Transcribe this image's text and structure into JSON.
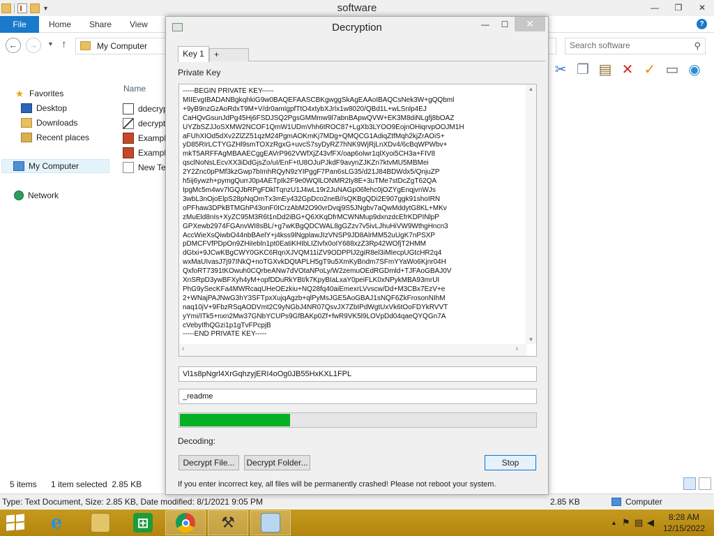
{
  "explorer": {
    "title": "software",
    "ribbon_tabs": [
      "File",
      "Home",
      "Share",
      "View"
    ],
    "address": "My Computer",
    "search_placeholder": "Search software",
    "column_name": "Name",
    "nav": {
      "favorites": "Favorites",
      "desktop": "Desktop",
      "downloads": "Downloads",
      "recent": "Recent places",
      "computer": "My Computer",
      "network": "Network"
    },
    "files": [
      "ddecryp",
      "decrypt",
      "Exampl",
      "Exampl",
      "New Te"
    ],
    "status_items": "5 items",
    "status_selected": "1 item selected  2.85 KB",
    "details_left": "Type: Text Document, Size: 2.85 KB, Date modified: 8/1/2021 9:05 PM",
    "details_size": "2.85 KB",
    "details_computer": "Computer"
  },
  "dialog": {
    "title": "Decryption",
    "tabs": [
      "Key 1",
      "+"
    ],
    "private_key_label": "Private Key",
    "private_key_text": "-----BEGIN PRIVATE KEY-----\nMIIEvgIBADANBgkqhkiG9w0BAQEFAASCBKgwggSkAgEAAoIBAQCsNek3W+gQQbml\n+9yB9nzGzAoRdxT9M+V/dr0amIgpfTtO4xtybXJrlx1w8020/QBd1L+wLSnlp4EJ\nCaHQvGsunJdPg45Hj6FSDJSQ2PgsGMMmw9l7abnBApwQVW+EK3M8diNLgfj8bOAZ\nUYZbSZJJoSXMW2NCOF1QmW1UDmVhh6tROC87+LgXb3LYOO9EojnOHiqrvpOOJM1H\naFUhXIOd5dXv2ZlZZ51qzM24PgmAOKmKj7MDg+QMQCG1AdiqZtfMqh2kjZrAOiS+\nyD85RIrLCTYGZHl9smTOXzRgxG+uvcS7syDyRZ7hNK9WjRjLnXDv4/6cBqWPWbv+\nmkT5ARFFAgMBAAECggEAVrP962VWfXjZ43vfFX/oap6oIwr1qlXyoi5CH3a+FIV8\nqsclNoNsLEcvXX3iDdGjsZo/uI/EnF+tU8OJuPJkdF9avynZJKZn7ktvMU5MBMei\n2Y2Znc0pPMf3kzGwp7bImhRQyN9zYIPggF7Pan6sLG35/d21J84BDWdx5/QnjuZP\nh5ij6ywzh+pymgQurrJ0p4AETpIk2F9e0WQlLONMR2Iy8E+3uTMe7stDcZgT62QA\nIpgMc5m4wv7lGQJbRPgFDklTqnzU1J4wL19r2JuNAGp06fehc0jOZYgEnqjvnWJs\n3wbL3nOjoElpS28pNqOmTx3mEy432GpDco2neB//sQKBgQDi2E907ggk91shoIRN\noPFhaw3DPkBTMGhP43onF0ICrzAbM2O90vrDvqj9S5JNgbv7aQwMddytG8KL+MKv\nzMuEld8nIs+XyZC95M3R6t1nDd2iBG+Q6XKqDfrMCWNMup9dxnzdcEfrKDPINlpP\nGPXewb2974FGAnvWI8sBL/+g7wKBgQDCWAL8gGZzv7v5ivLJhuHiVW9WthgHncn3\nAccWieXsQiwbO44nbBAelY+j4kss9lNgplawJIzVNSP9JD8AlrMM52uUgK7nPSXP\npDMCFVfPDpOn9ZHiIebln1pt0EatiKHIbLIZIvfx0oIY688xzZ3Rp42WOfjT2HMM\ndGtxi+9JCwKBgCWY0GKC6RqnXJVQM11iZV9ODPPlJ2giR8el3iMIecpUGtcHR2q4\nwxMaUIvasJ7j97INkQ+noTGXvkDQtAPLH5gT9u5XmKyBndm7SFmYYaWo6Kjnr04H\nQxfoRT7391tKOwuh0CQrbeANw7dVOtaNPoLy/W2zemuOEdRGDmld+TJFAoGBAJ0V\nXnSRpD3ywBFXyh4yM+opfDDuRkYBt/k7KpyBIaLxaY0peiFLK0xNPykMBA93mrUI\nPhG9ySecKFa4MWRcaqUHeOEzkiu+NQ28fq40aiEmexrLVvscw/Dd+M3CBx7EzV+e\n2+WNajPAJNwG3hY3SFTpxXujqAgzb+qlPyMsJGE5AoGBAJ1sNQF6ZkFrosonNIhM\nnaq10jV+9FbzRSqAODVmt2C9yNGbJ4NR07QsvJX7ZbIPdWgtUxVk6tOoFDYkRVVT\nyYmi/ITk5+nxn2Mw37GNbYCUPs9GfBAKp0Zf+fwR9VK5l9LOVpDd04qaeQYQGn7A\ncVebyIfhQGzi1p1gTvFPcpjB\n-----END PRIVATE KEY-----",
    "key_id_value": "Vl1s8pNgrl4XrGqhzyjERI4oOg0JB55HxKXL1FPL",
    "extension_value": "_readme",
    "progress_fraction": 0.31,
    "status_label": "Decoding:",
    "decrypt_file_button": "Decrypt File...",
    "decrypt_folder_button": "Decrypt Folder...",
    "stop_button": "Stop",
    "warning": "If you enter incorrect key, all files will be permanently crashed! Please not reboot your system."
  },
  "taskbar": {
    "time": "8:28 AM",
    "date": "12/15/2022",
    "apps": [
      "file-explorer",
      "internet-explorer",
      "store",
      "chrome",
      "tool",
      "notepad"
    ]
  },
  "colors": {
    "accent": "#1979ca",
    "taskbar": "#c69a1e",
    "progress": "#06b025"
  }
}
